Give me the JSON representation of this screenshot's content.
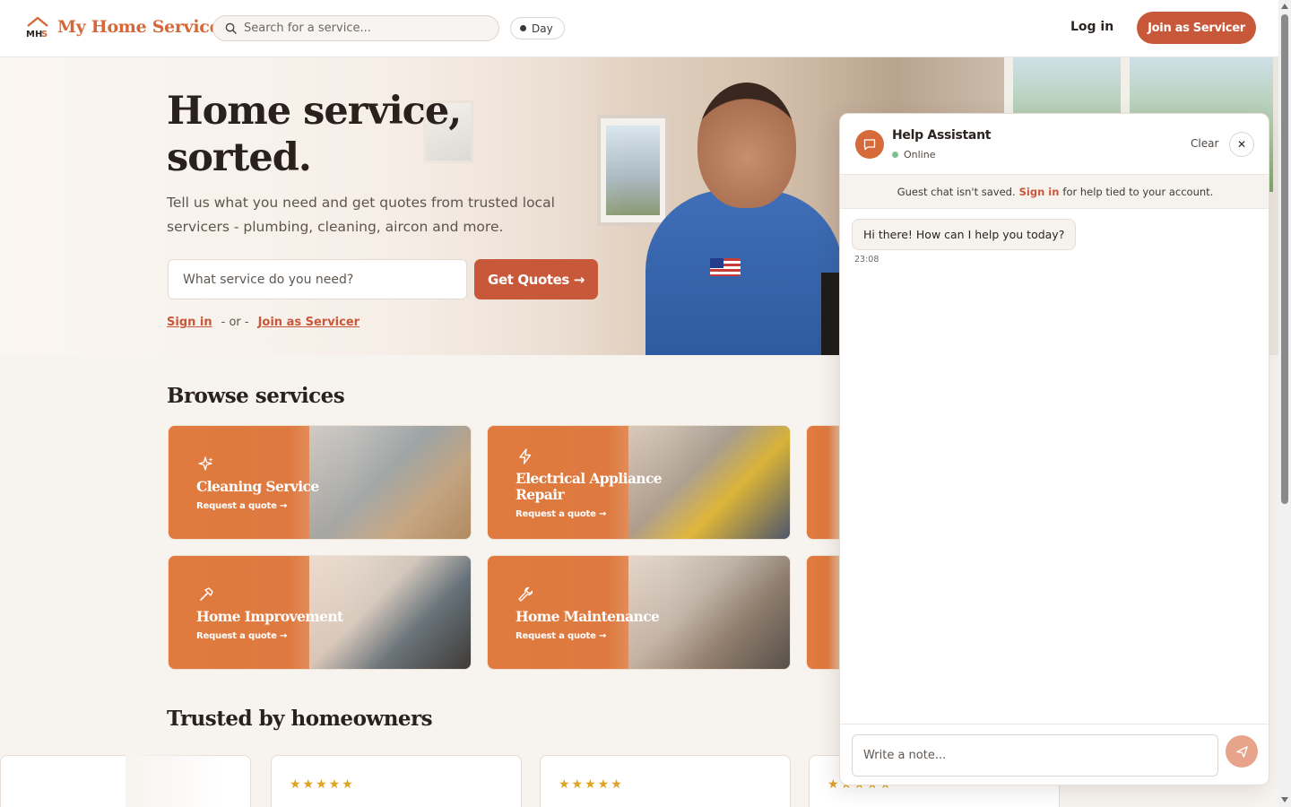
{
  "header": {
    "brand": "My Home Servicer",
    "search_placeholder": "Search for a service...",
    "theme_toggle": "Day",
    "login": "Log in",
    "join": "Join as Servicer"
  },
  "hero": {
    "title_line1": "Home service,",
    "title_line2": "sorted.",
    "subtitle": "Tell us what you need and get quotes from trusted local servicers - plumbing, cleaning, aircon and more.",
    "input_placeholder": "What service do you need?",
    "cta": "Get Quotes →",
    "sign_in": "Sign in",
    "or": "- or -",
    "join": "Join as Servicer"
  },
  "browse": {
    "title": "Browse services",
    "cards": [
      {
        "title": "Cleaning Service",
        "cta": "Request a quote →",
        "icon": "sparkle-icon"
      },
      {
        "title": "Electrical Appliance Repair",
        "cta": "Request a quote →",
        "icon": "bolt-icon"
      },
      {
        "title": "Home Improvement",
        "cta": "Request a quote →",
        "icon": "hammer-icon"
      },
      {
        "title": "Home Maintenance",
        "cta": "Request a quote →",
        "icon": "wrench-icon"
      }
    ]
  },
  "reviews": {
    "title": "Trusted by homeowners",
    "stars": "★★★★★"
  },
  "chat": {
    "title": "Help Assistant",
    "status": "Online",
    "clear": "Clear",
    "close": "✕",
    "notice_before": "Guest chat isn't saved.",
    "notice_link": "Sign in",
    "notice_after": "for help tied to your account.",
    "message": "Hi there! How can I help you today?",
    "time": "23:08",
    "input_placeholder": "Write a note..."
  },
  "colors": {
    "brand": "#c8583a",
    "brand_logo": "#d4683a",
    "card": "#e07a3e",
    "star": "#e0a21f",
    "online": "#7fbf8f"
  }
}
